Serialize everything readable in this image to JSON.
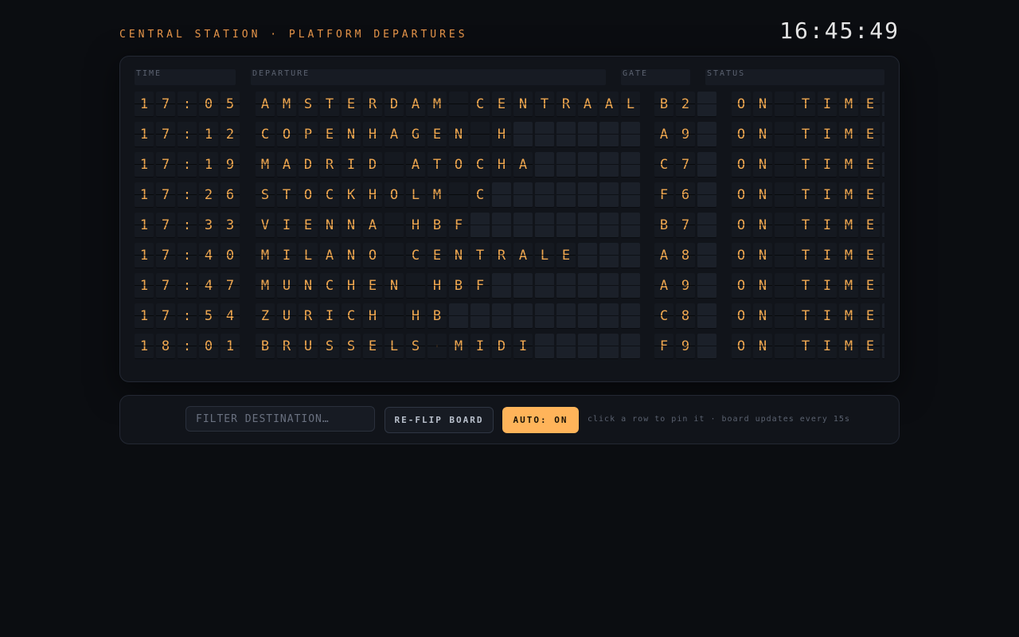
{
  "header": {
    "title": "CENTRAL STATION · PLATFORM DEPARTURES",
    "clock": "16:45:49"
  },
  "board": {
    "columns": {
      "time": "TIME",
      "departure": "DEPARTURE",
      "gate": "GATE",
      "status": "STATUS"
    },
    "rows": [
      {
        "time": "17:05",
        "departure": "AMSTERDAM CENTRAAL",
        "gate": "B2",
        "status": "ON TIME"
      },
      {
        "time": "17:12",
        "departure": "COPENHAGEN H",
        "gate": "A9",
        "status": "ON TIME"
      },
      {
        "time": "17:19",
        "departure": "MADRID ATOCHA",
        "gate": "C7",
        "status": "ON TIME"
      },
      {
        "time": "17:26",
        "departure": "STOCKHOLM C",
        "gate": "F6",
        "status": "ON TIME"
      },
      {
        "time": "17:33",
        "departure": "VIENNA HBF",
        "gate": "B7",
        "status": "ON TIME"
      },
      {
        "time": "17:40",
        "departure": "MILANO CENTRALE",
        "gate": "A8",
        "status": "ON TIME"
      },
      {
        "time": "17:47",
        "departure": "MUNCHEN HBF",
        "gate": "A9",
        "status": "ON TIME"
      },
      {
        "time": "17:54",
        "departure": "ZURICH HB",
        "gate": "C8",
        "status": "ON TIME"
      },
      {
        "time": "18:01",
        "departure": "BRUSSELS-MIDI",
        "gate": "F9",
        "status": "ON TIME"
      }
    ]
  },
  "controls": {
    "filter_placeholder": "FILTER DESTINATION…",
    "reflip_label": "RE-FLIP BOARD",
    "auto_label": "AUTO: ON",
    "hint": "click a row to pin it · board updates every 15s"
  },
  "colors": {
    "background": "#0b0d11",
    "flap_text": "#f0a850",
    "accent_button": "#ffb45a"
  }
}
